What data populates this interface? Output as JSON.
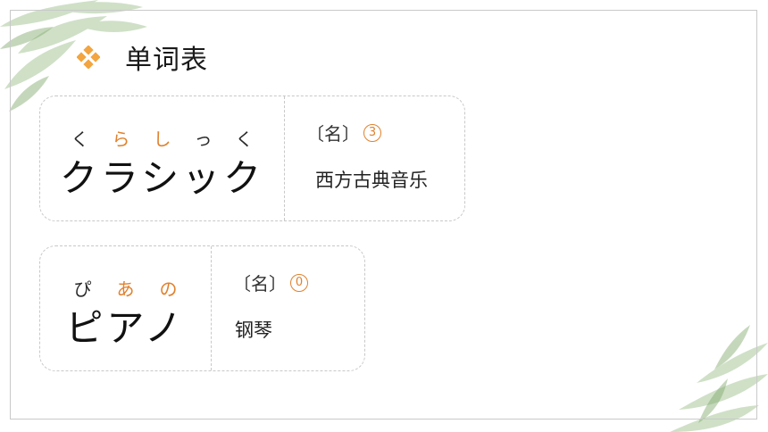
{
  "title": "单词表",
  "colors": {
    "accent": "#e0822f",
    "title_icon": "#f2a540",
    "frame": "#c9c9c9",
    "leaf": "#9cbf86"
  },
  "words": [
    {
      "kana": [
        "く",
        "ら",
        "し",
        "っ",
        "く"
      ],
      "kana_highlight": [
        false,
        true,
        true,
        false,
        false
      ],
      "katakana": "クラシック",
      "pos": "〔名〕",
      "accent": "3",
      "meaning": "西方古典音乐"
    },
    {
      "kana": [
        "ぴ",
        "あ",
        "の"
      ],
      "kana_highlight": [
        false,
        true,
        true
      ],
      "katakana": "ピアノ",
      "pos": "〔名〕",
      "accent": "0",
      "meaning": "钢琴"
    }
  ]
}
